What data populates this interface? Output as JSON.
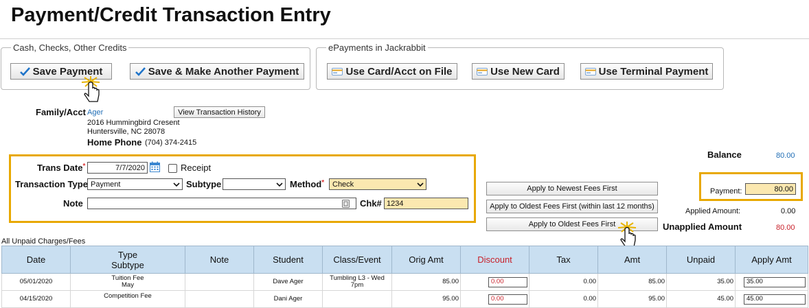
{
  "page": {
    "title": "Payment/Credit Transaction Entry"
  },
  "cash_group": {
    "legend": "Cash, Checks, Other Credits",
    "save_payment": "Save Payment",
    "save_another": "Save & Make Another Payment"
  },
  "epay_group": {
    "legend": "ePayments in Jackrabbit",
    "use_card_on_file": "Use Card/Acct on File",
    "use_new_card": "Use New Card",
    "use_terminal": "Use Terminal Payment"
  },
  "family": {
    "label": "Family/Acct",
    "name": "Ager",
    "view_history": "View Transaction History",
    "address1": "2016 Hummingbird Cresent",
    "address2": "Huntersville, NC  28078",
    "phone_label": "Home Phone",
    "phone": "(704) 374-2415"
  },
  "form": {
    "trans_date_label": "Trans Date",
    "trans_date": "7/7/2020",
    "receipt_label": "Receipt",
    "transaction_type_label": "Transaction Type",
    "transaction_type": "Payment",
    "subtype_label": "Subtype",
    "subtype": "",
    "method_label": "Method",
    "method": "Check",
    "note_label": "Note",
    "note": "",
    "chk_label": "Chk#",
    "chk": "1234"
  },
  "apply": {
    "newest": "Apply to Newest Fees First",
    "oldest_12": "Apply to Oldest Fees First (within last 12 months)",
    "oldest": "Apply to Oldest Fees First"
  },
  "summary": {
    "balance_label": "Balance",
    "balance": "80.00",
    "payment_label": "Payment:",
    "payment": "80.00",
    "applied_label": "Applied Amount:",
    "applied": "0.00",
    "unapplied_label": "Unapplied Amount",
    "unapplied": "80.00"
  },
  "table": {
    "caption": "All Unpaid Charges/Fees",
    "headers": {
      "date": "Date",
      "type": "Type",
      "subtype": "Subtype",
      "note": "Note",
      "student": "Student",
      "class": "Class/Event",
      "orig": "Orig Amt",
      "discount": "Discount",
      "tax": "Tax",
      "amt": "Amt",
      "unpaid": "Unpaid",
      "apply": "Apply Amt"
    },
    "rows": [
      {
        "date": "05/01/2020",
        "type": "Tuition Fee",
        "subtype": "May",
        "note": "",
        "student": "Dave Ager",
        "class1": "Tumbling L3 - Wed",
        "class2": "7pm",
        "orig": "85.00",
        "discount": "0.00",
        "tax": "0.00",
        "amt": "85.00",
        "unpaid": "35.00",
        "apply": "35.00"
      },
      {
        "date": "04/15/2020",
        "type": "Competition Fee",
        "subtype": "",
        "note": "",
        "student": "Dani Ager",
        "class1": "",
        "class2": "",
        "orig": "95.00",
        "discount": "0.00",
        "tax": "0.00",
        "amt": "95.00",
        "unpaid": "45.00",
        "apply": "45.00"
      }
    ]
  },
  "colors": {
    "highlight": "#e8a800",
    "header_bg": "#c9dff1",
    "link": "#1f6db5",
    "red": "#c8202a",
    "input_yellow": "#fbe8b0"
  },
  "icons": {
    "save": "checkmark-icon",
    "card": "credit-card-icon",
    "calendar": "calendar-icon",
    "pointer": "hand-pointer-icon"
  }
}
